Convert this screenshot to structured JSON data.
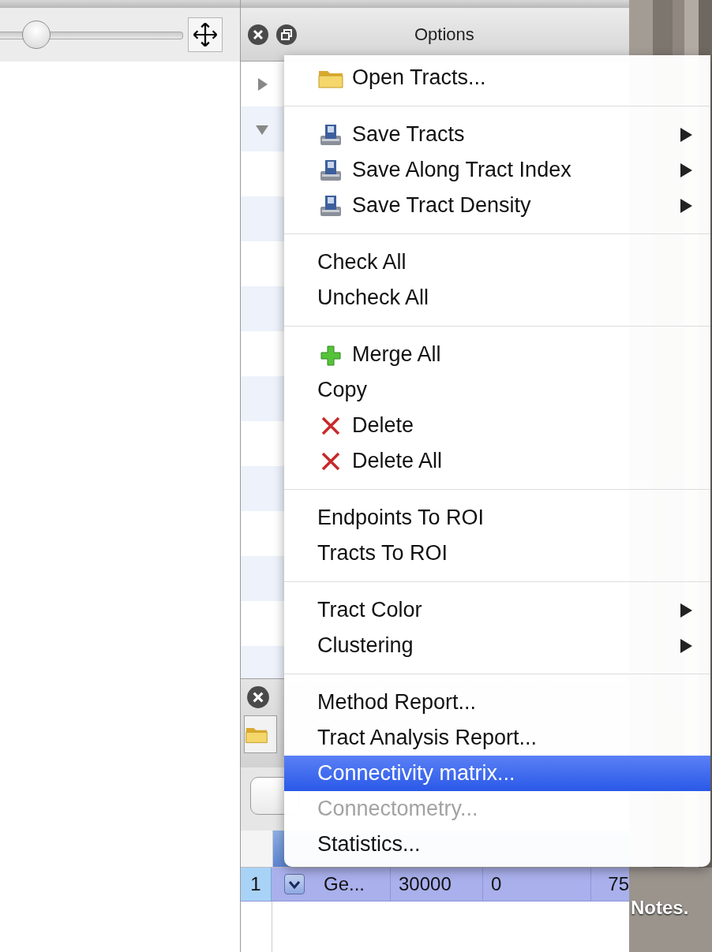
{
  "toolbar": {
    "slider": {
      "level": 0.2
    }
  },
  "options_panel": {
    "title": "Options",
    "tree_rows": [
      {
        "expanded": false
      },
      {
        "expanded": true
      }
    ]
  },
  "tracts_panel": {
    "table": {
      "rows": [
        {
          "number": "1",
          "selected": true,
          "checked": true,
          "cells": [
            "Ge...",
            "30000",
            "0",
            "75"
          ]
        }
      ]
    }
  },
  "desktop": {
    "label": "Notes."
  },
  "menu": {
    "sections": [
      {
        "items": [
          {
            "label": "Open Tracts...",
            "kind": "open",
            "submenu": false,
            "selected": false,
            "disabled": false
          }
        ]
      },
      {
        "items": [
          {
            "label": "Save Tracts",
            "kind": "save",
            "submenu": true,
            "selected": false,
            "disabled": false
          },
          {
            "label": "Save Along Tract Index",
            "kind": "save",
            "submenu": true,
            "selected": false,
            "disabled": false
          },
          {
            "label": "Save Tract Density",
            "kind": "save",
            "submenu": true,
            "selected": false,
            "disabled": false
          }
        ]
      },
      {
        "items": [
          {
            "label": "Check All",
            "kind": "plain",
            "submenu": false,
            "selected": false,
            "disabled": false
          },
          {
            "label": "Uncheck All",
            "kind": "plain",
            "submenu": false,
            "selected": false,
            "disabled": false
          }
        ]
      },
      {
        "items": [
          {
            "label": "Merge All",
            "kind": "merge",
            "submenu": false,
            "selected": false,
            "disabled": false
          },
          {
            "label": "Copy",
            "kind": "plain",
            "submenu": false,
            "selected": false,
            "disabled": false
          },
          {
            "label": "Delete",
            "kind": "delete",
            "submenu": false,
            "selected": false,
            "disabled": false
          },
          {
            "label": "Delete All",
            "kind": "delete",
            "submenu": false,
            "selected": false,
            "disabled": false
          }
        ]
      },
      {
        "items": [
          {
            "label": "Endpoints To ROI",
            "kind": "plain",
            "submenu": false,
            "selected": false,
            "disabled": false
          },
          {
            "label": "Tracts To ROI",
            "kind": "plain",
            "submenu": false,
            "selected": false,
            "disabled": false
          }
        ]
      },
      {
        "items": [
          {
            "label": "Tract Color",
            "kind": "plain",
            "submenu": true,
            "selected": false,
            "disabled": false
          },
          {
            "label": "Clustering",
            "kind": "plain",
            "submenu": true,
            "selected": false,
            "disabled": false
          }
        ]
      },
      {
        "items": [
          {
            "label": "Method Report...",
            "kind": "plain",
            "submenu": false,
            "selected": false,
            "disabled": false
          },
          {
            "label": "Tract Analysis Report...",
            "kind": "plain",
            "submenu": false,
            "selected": false,
            "disabled": false
          },
          {
            "label": "Connectivity matrix...",
            "kind": "plain",
            "submenu": false,
            "selected": true,
            "disabled": false
          },
          {
            "label": "Connectometry...",
            "kind": "plain",
            "submenu": false,
            "selected": false,
            "disabled": true
          },
          {
            "label": "Statistics...",
            "kind": "plain",
            "submenu": false,
            "selected": false,
            "disabled": false
          }
        ]
      }
    ]
  }
}
